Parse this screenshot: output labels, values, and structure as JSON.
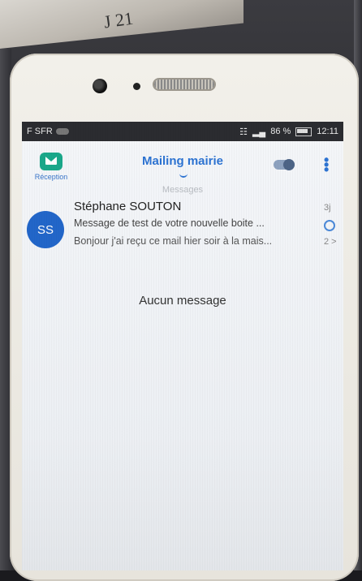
{
  "photo": {
    "paper_text": "J 21"
  },
  "statusbar": {
    "carrier": "F SFR",
    "battery_pct": "86 %",
    "clock": "12:11"
  },
  "appbar": {
    "inbox_label": "Réception",
    "title": "Mailing mairie"
  },
  "list": {
    "date_divider": "Messages",
    "messages": [
      {
        "avatar_initials": "SS",
        "sender": "Stéphane SOUTON",
        "subject": "Message de test de votre nouvelle boite ...",
        "preview": "Bonjour j'ai reçu ce mail hier soir à la mais...",
        "time": "3j",
        "thread_count": "2 >"
      }
    ],
    "empty_text": "Aucun message"
  },
  "colors": {
    "accent": "#2c73d2",
    "avatar": "#2266c9",
    "inbox_icon": "#1aa88a"
  },
  "icons": {
    "inbox": "inbox-mail-icon",
    "overflow": "overflow-menu-icon",
    "toggle": "toggle-icon"
  }
}
